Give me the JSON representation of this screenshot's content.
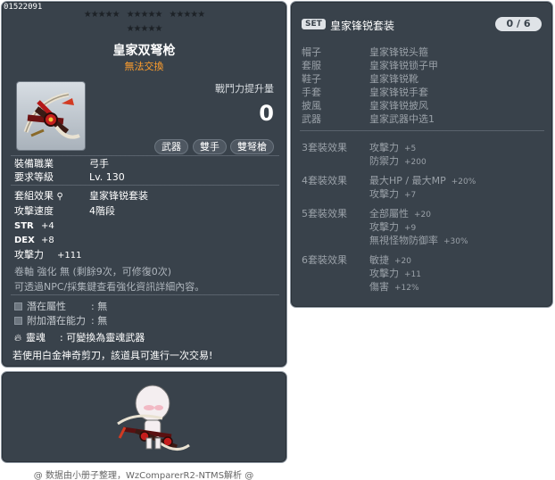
{
  "item": {
    "id": "01522091",
    "name": "皇家双弩枪",
    "sub": "無法交換",
    "combat_label": "戰鬥力提升量",
    "combat_value": "0",
    "tags": [
      "武器",
      "雙手",
      "雙弩槍"
    ],
    "job_label": "裝備職業",
    "job_value": "弓手",
    "level_label": "要求等級",
    "level_value": "Lv. 130",
    "set_label": "套組效果",
    "set_value": "皇家锋锐套装",
    "speed_label": "攻擊速度",
    "speed_value": "4階段",
    "stats": [
      {
        "label": "STR",
        "value": "+4"
      },
      {
        "label": "DEX",
        "value": "+8"
      },
      {
        "label": "攻擊力",
        "value": "+111"
      }
    ],
    "upgrade_line": "卷軸 強化 無 (剩餘9次，可修復0次)",
    "npc_line": "可透過NPC/採集鍵查看強化資訊詳細內容。",
    "potential_label": "潛在屬性",
    "potential_value": ": 無",
    "add_potential_label": "附加潛在能力",
    "add_potential_value": ": 無",
    "soul_label": "靈魂",
    "soul_value": ": 可變換為靈魂武器",
    "scissors_line": "若使用白金神奇剪刀，該道具可進行一次交易!"
  },
  "set": {
    "badge": "SET",
    "title": "皇家锋锐套装",
    "count": "0 / 6",
    "pieces": [
      {
        "slot": "帽子",
        "name": "皇家锋锐头箍"
      },
      {
        "slot": "套服",
        "name": "皇家锋锐锁子甲"
      },
      {
        "slot": "鞋子",
        "name": "皇家锋锐靴"
      },
      {
        "slot": "手套",
        "name": "皇家锋锐手套"
      },
      {
        "slot": "披風",
        "name": "皇家锋锐披风"
      },
      {
        "slot": "武器",
        "name": "皇家武器中选1"
      }
    ],
    "effects": [
      {
        "title": "3套裝效果",
        "lines": [
          {
            "name": "攻擊力",
            "value": "+5"
          },
          {
            "name": "防禦力",
            "value": "+200"
          }
        ]
      },
      {
        "title": "4套裝效果",
        "lines": [
          {
            "name": "最大HP / 最大MP",
            "value": "+20%"
          },
          {
            "name": "攻擊力",
            "value": "+7"
          }
        ]
      },
      {
        "title": "5套裝效果",
        "lines": [
          {
            "name": "全部屬性",
            "value": "+20"
          },
          {
            "name": "攻擊力",
            "value": "+9"
          },
          {
            "name": "無視怪物防御率",
            "value": "+30%"
          }
        ]
      },
      {
        "title": "6套裝效果",
        "lines": [
          {
            "name": "敏捷",
            "value": "+20"
          },
          {
            "name": "攻擊力",
            "value": "+11"
          },
          {
            "name": "傷害",
            "value": "+12%"
          }
        ]
      }
    ]
  },
  "footer": "@ 数据由小册子整理，WzComparerR2-NTMS解析 @"
}
